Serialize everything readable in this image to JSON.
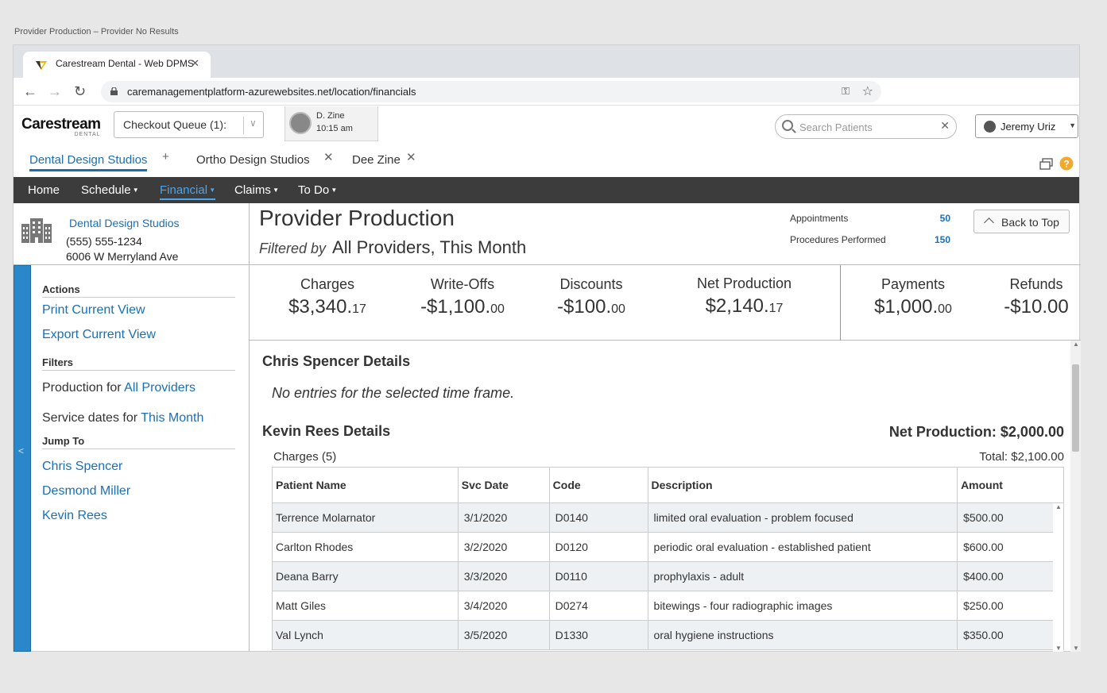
{
  "caption": "Provider Production – Provider No Results",
  "browser": {
    "tab_title": "Carestream Dental - Web DPMS",
    "url": "caremanagementplatform-azurewebsites.net/location/financials"
  },
  "header": {
    "logo_text": "Carestream",
    "logo_sub": "DENTAL",
    "queue_label": "Checkout Queue (1):",
    "user_chip_name": "D. Zine",
    "user_chip_time": "10:15 am",
    "search_placeholder": "Search Patients",
    "user_name": "Jeremy Uriz"
  },
  "location_tabs": [
    {
      "label": "Dental Design Studios"
    },
    {
      "label": "Ortho Design Studios"
    },
    {
      "label": "Dee Zine"
    }
  ],
  "menu": [
    {
      "label": "Home"
    },
    {
      "label": "Schedule"
    },
    {
      "label": "Financial"
    },
    {
      "label": "Claims"
    },
    {
      "label": "To Do"
    }
  ],
  "location": {
    "name": "Dental Design Studios",
    "phone": "(555) 555-1234",
    "address": "6006 W Merryland Ave"
  },
  "sidebar": {
    "actions_heading": "Actions",
    "print": "Print Current View",
    "export": "Export Current View",
    "filters_heading": "Filters",
    "prod_prefix": "Production for",
    "prod_value": "All Providers",
    "svc_prefix": "Service dates for",
    "svc_value": "This Month",
    "jump_heading": "Jump To",
    "jump": [
      "Chris Spencer",
      "Desmond Miller",
      "Kevin Rees"
    ]
  },
  "page": {
    "title": "Provider Production",
    "filtered_by": "Filtered by",
    "filter_value": "All Providers, This Month",
    "appointments_label": "Appointments",
    "appointments_value": "50",
    "procedures_label": "Procedures Performed",
    "procedures_value": "150",
    "back_to_top": "Back to Top"
  },
  "summary": {
    "charges": {
      "label": "Charges",
      "main": "$3,340.",
      "cents": "17"
    },
    "writeoffs": {
      "label": "Write-Offs",
      "main": "-$1,100.",
      "cents": "00"
    },
    "discounts": {
      "label": "Discounts",
      "main": "-$100.",
      "cents": "00"
    },
    "net": {
      "label": "Net Production",
      "main": "$2,140.",
      "cents": "17"
    },
    "payments": {
      "label": "Payments",
      "main": "$1,000.",
      "cents": "00"
    },
    "refunds": {
      "label": "Refunds",
      "main": "-$10.00",
      "cents": ""
    }
  },
  "details": {
    "chris_heading": "Chris Spencer Details",
    "no_entries": "No entries for the selected time frame.",
    "kevin_heading": "Kevin Rees Details",
    "kevin_net": "Net Production: $2,000.00",
    "charges_label": "Charges (5)",
    "charges_total": "Total: $2,100.00",
    "columns": [
      "Patient Name",
      "Svc Date",
      "Code",
      "Description",
      "Amount"
    ],
    "rows": [
      [
        "Terrence Molarnator",
        "3/1/2020",
        "D0140",
        "limited oral evaluation - problem focused",
        "$500.00"
      ],
      [
        "Carlton Rhodes",
        "3/2/2020",
        "D0120",
        "periodic oral evaluation - established patient",
        "$600.00"
      ],
      [
        "Deana Barry",
        "3/3/2020",
        "D0110",
        "prophylaxis - adult",
        "$400.00"
      ],
      [
        "Matt Giles",
        "3/4/2020",
        "D0274",
        "bitewings - four radiographic images",
        "$250.00"
      ],
      [
        "Val Lynch",
        "3/5/2020",
        "D1330",
        "oral hygiene instructions",
        "$350.00"
      ]
    ]
  },
  "colors": {
    "accent": "#1a6fb4",
    "menubar": "#3c3c3c",
    "sidebar_bar": "#2a87c9"
  }
}
